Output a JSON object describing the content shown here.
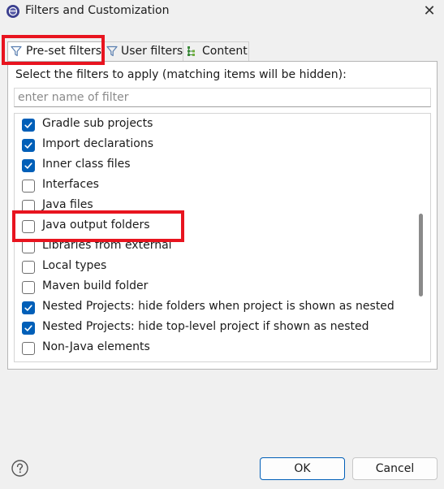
{
  "window": {
    "title": "Filters and Customization",
    "close_glyph": "✕"
  },
  "tabs": [
    {
      "label": "Pre-set filters",
      "icon": "filter-icon",
      "active": true
    },
    {
      "label": "User filters",
      "icon": "filter-icon",
      "active": false
    },
    {
      "label": "Content",
      "icon": "content-tree-icon",
      "active": false
    }
  ],
  "panel": {
    "instructions": "Select the filters to apply (matching items will be hidden):",
    "filter_placeholder": "enter name of filter",
    "filter_value": ""
  },
  "items": [
    {
      "label": "Gradle sub projects",
      "checked": true
    },
    {
      "label": "Import declarations",
      "checked": true
    },
    {
      "label": "Inner class files",
      "checked": true
    },
    {
      "label": "Interfaces",
      "checked": false
    },
    {
      "label": "Java files",
      "checked": false
    },
    {
      "label": "Java output folders",
      "checked": false
    },
    {
      "label": "Libraries from external",
      "checked": false
    },
    {
      "label": "Local types",
      "checked": false
    },
    {
      "label": "Maven build folder",
      "checked": false
    },
    {
      "label": "Nested Projects: hide folders when project is shown as nested",
      "checked": true
    },
    {
      "label": "Nested Projects: hide top-level project if shown as nested",
      "checked": true
    },
    {
      "label": "Non-Java elements",
      "checked": false
    }
  ],
  "scrollbar": {
    "thumb_fraction": 0.33
  },
  "buttons": {
    "ok": "OK",
    "cancel": "Cancel"
  },
  "colors": {
    "accent": "#005fb8",
    "highlight": "#e8141f"
  }
}
